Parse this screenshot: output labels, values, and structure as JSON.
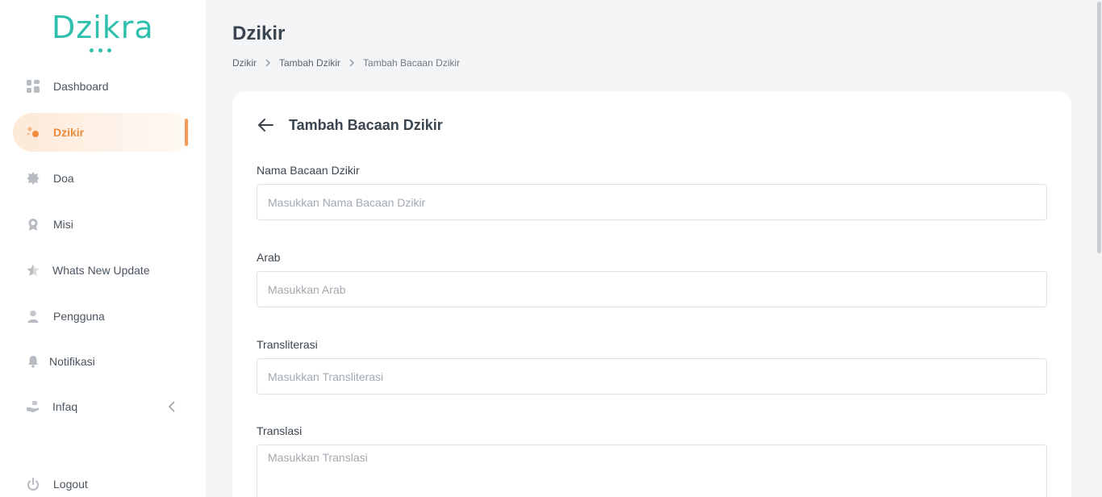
{
  "brand": {
    "name": "Dzikra"
  },
  "sidebar": {
    "items": [
      {
        "label": "Dashboard",
        "icon": "dashboard-grid-icon"
      },
      {
        "label": "Dzikir",
        "icon": "dzikir-beads-icon",
        "active": true
      },
      {
        "label": "Doa",
        "icon": "star-badge-icon"
      },
      {
        "label": "Misi",
        "icon": "award-ribbon-icon"
      },
      {
        "label": "Whats New Update",
        "icon": "star-half-icon"
      },
      {
        "label": "Pengguna",
        "icon": "user-icon"
      },
      {
        "label": "Notifikasi",
        "icon": "bell-icon"
      },
      {
        "label": "Infaq",
        "icon": "hand-gift-icon",
        "has_submenu": true
      }
    ],
    "logout": {
      "label": "Logout",
      "icon": "power-icon"
    }
  },
  "header": {
    "title": "Dzikir",
    "breadcrumb": [
      "Dzikir",
      "Tambah Dzikir",
      "Tambah Bacaan Dzikir"
    ]
  },
  "form": {
    "title": "Tambah Bacaan Dzikir",
    "fields": [
      {
        "label": "Nama Bacaan Dzikir",
        "placeholder": "Masukkan Nama Bacaan Dzikir",
        "value": ""
      },
      {
        "label": "Arab",
        "placeholder": "Masukkan Arab",
        "value": ""
      },
      {
        "label": "Transliterasi",
        "placeholder": "Masukkan Transliterasi",
        "value": ""
      },
      {
        "label": "Translasi",
        "placeholder": "Masukkan Translasi",
        "value": ""
      }
    ]
  },
  "colors": {
    "brand": "#2ec0ad",
    "active_text": "#e98a3b",
    "active_bar": "#f39a5a",
    "page_bg": "#f3f5f7"
  }
}
